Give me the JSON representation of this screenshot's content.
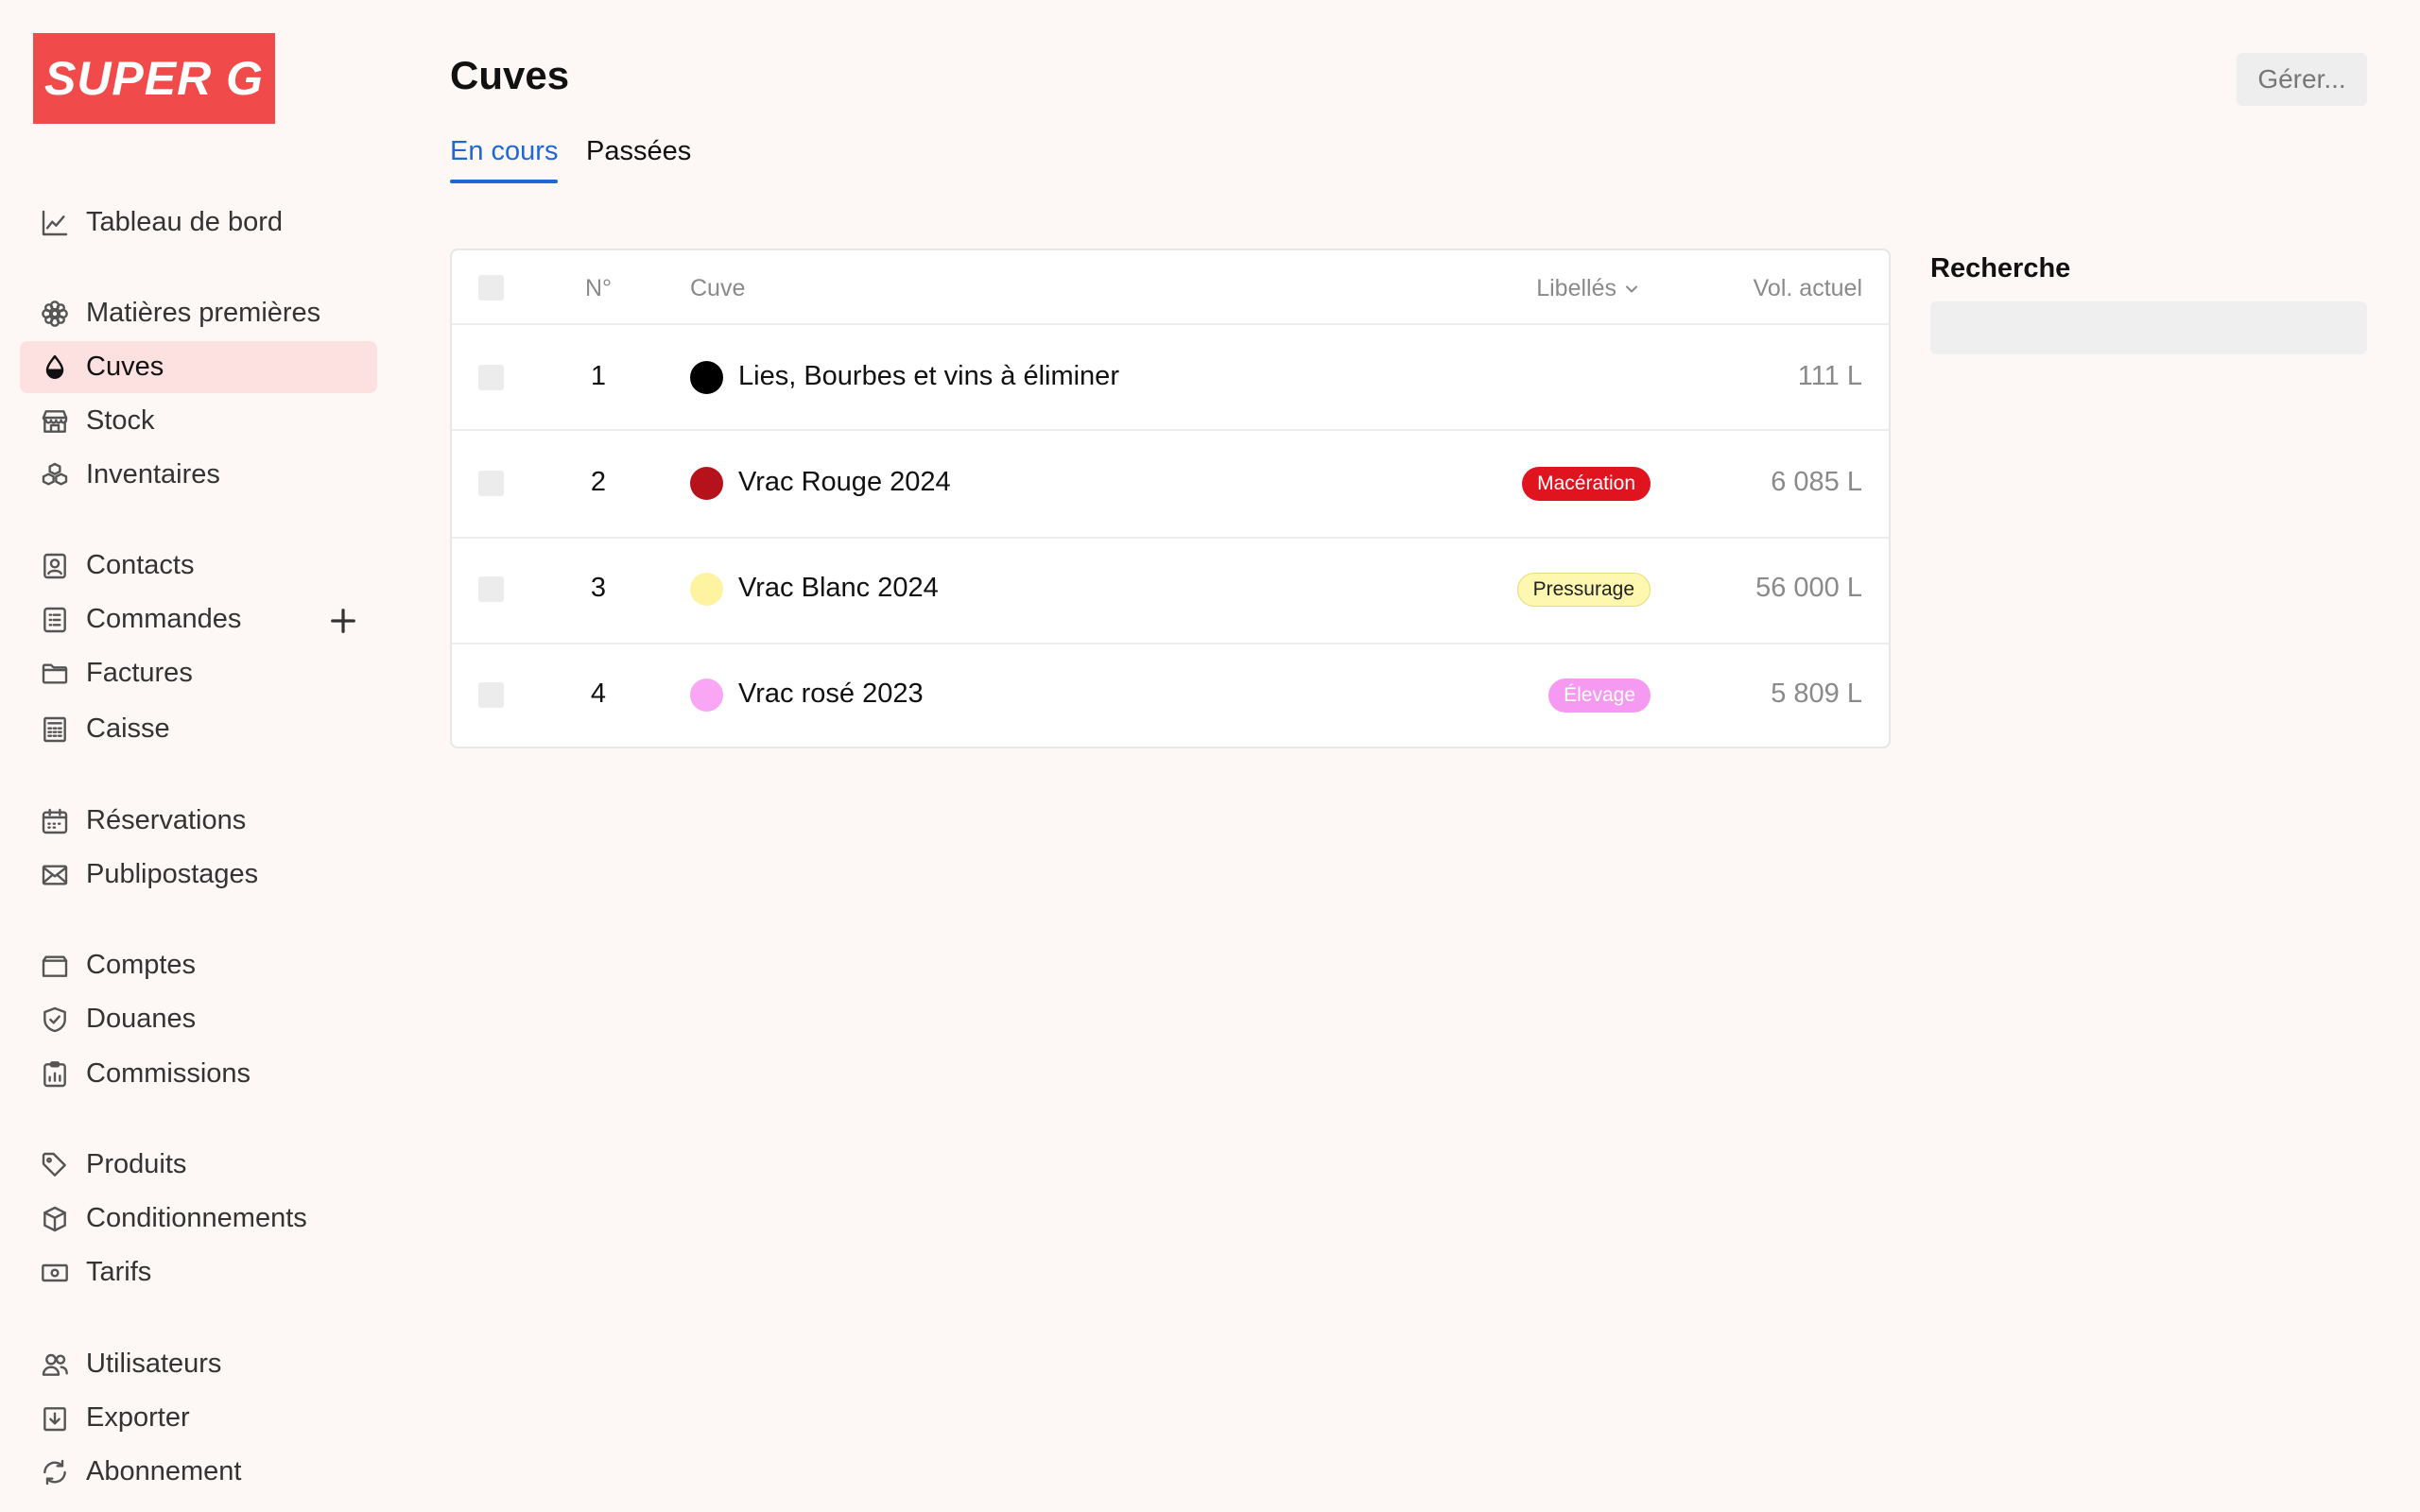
{
  "brand": {
    "logo_text": "SUPER G"
  },
  "sidebar": {
    "items": [
      {
        "label": "Tableau de bord",
        "icon": "chart-line-icon"
      },
      {
        "label": "Matières premières",
        "icon": "flower-icon"
      },
      {
        "label": "Cuves",
        "icon": "drop-icon",
        "active": true
      },
      {
        "label": "Stock",
        "icon": "store-icon"
      },
      {
        "label": "Inventaires",
        "icon": "cubes-icon"
      },
      {
        "label": "Contacts",
        "icon": "contact-card-icon"
      },
      {
        "label": "Commandes",
        "icon": "order-list-icon"
      },
      {
        "label": "Factures",
        "icon": "folder-icon"
      },
      {
        "label": "Caisse",
        "icon": "calculator-icon"
      },
      {
        "label": "Réservations",
        "icon": "calendar-icon"
      },
      {
        "label": "Publipostages",
        "icon": "envelope-icon"
      },
      {
        "label": "Comptes",
        "icon": "wallet-icon"
      },
      {
        "label": "Douanes",
        "icon": "shield-icon"
      },
      {
        "label": "Commissions",
        "icon": "clipboard-chart-icon"
      },
      {
        "label": "Produits",
        "icon": "tag-icon"
      },
      {
        "label": "Conditionnements",
        "icon": "box-icon"
      },
      {
        "label": "Tarifs",
        "icon": "banknote-icon"
      },
      {
        "label": "Utilisateurs",
        "icon": "users-icon"
      },
      {
        "label": "Exporter",
        "icon": "download-icon"
      },
      {
        "label": "Abonnement",
        "icon": "refresh-icon"
      }
    ]
  },
  "header": {
    "title": "Cuves",
    "manage_label": "Gérer..."
  },
  "tabs": [
    {
      "label": "En cours",
      "active": true
    },
    {
      "label": "Passées",
      "active": false
    }
  ],
  "table": {
    "columns": {
      "num": "N°",
      "name": "Cuve",
      "labels": "Libellés",
      "volume": "Vol. actuel"
    },
    "rows": [
      {
        "num": "1",
        "name": "Lies, Bourbes et vins à éliminer",
        "color": "#000000",
        "badge": "",
        "badge_bg": "",
        "badge_fg": "",
        "volume": "111 L"
      },
      {
        "num": "2",
        "name": "Vrac Rouge 2024",
        "color": "#b5121b",
        "badge": "Macération",
        "badge_bg": "#e0141e",
        "badge_fg": "#ffffff",
        "volume": "6 085 L"
      },
      {
        "num": "3",
        "name": "Vrac Blanc 2024",
        "color": "#fdf3a0",
        "badge": "Pressurage",
        "badge_bg": "#fdf7b0",
        "badge_fg": "#222222",
        "volume": "56 000 L"
      },
      {
        "num": "4",
        "name": "Vrac rosé 2023",
        "color": "#f9a6f5",
        "badge": "Élevage",
        "badge_bg": "#f59af0",
        "badge_fg": "#ffffff",
        "volume": "5 809 L"
      }
    ]
  },
  "search": {
    "label": "Recherche",
    "value": "",
    "placeholder": ""
  }
}
